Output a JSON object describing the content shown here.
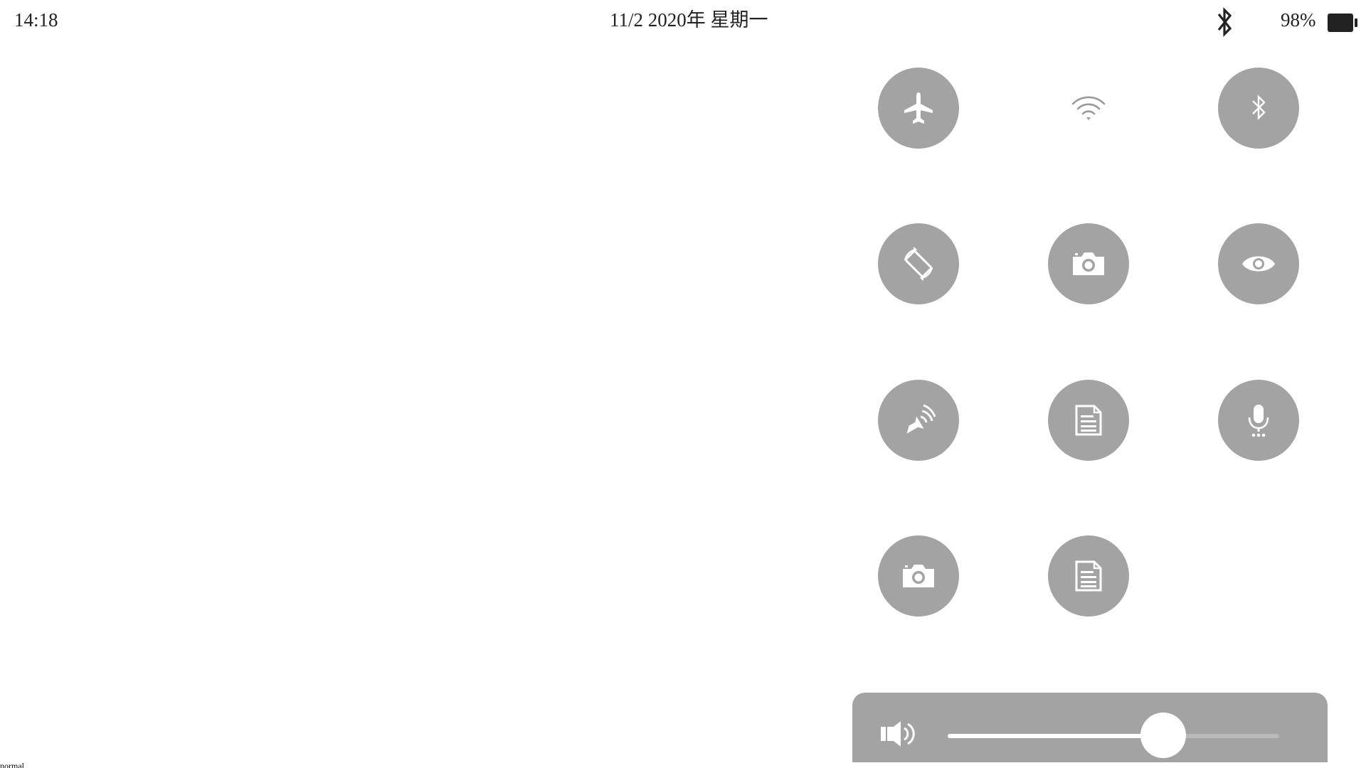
{
  "status_bar": {
    "time": "14:18",
    "date": "11/2 2020年 星期一",
    "bluetooth_icon": "bluetooth-icon",
    "battery_percent": "98%",
    "battery_icon": "battery-icon",
    "battery_level": 0.98
  },
  "controls": [
    {
      "name": "airplane-mode",
      "icon": "airplane-icon",
      "active": true
    },
    {
      "name": "wifi",
      "icon": "wifi-icon",
      "active": false
    },
    {
      "name": "bluetooth",
      "icon": "bluetooth-icon",
      "active": true
    },
    {
      "name": "rotation-lock",
      "icon": "rotate-icon",
      "active": true
    },
    {
      "name": "camera",
      "icon": "camera-icon",
      "active": true
    },
    {
      "name": "eye",
      "icon": "eye-icon",
      "active": true
    },
    {
      "name": "speaker-broadcast",
      "icon": "broadcast-icon",
      "active": true
    },
    {
      "name": "document",
      "icon": "document-icon",
      "active": true
    },
    {
      "name": "microphone",
      "icon": "microphone-icon",
      "active": true
    },
    {
      "name": "camera-2",
      "icon": "camera-icon",
      "active": true
    },
    {
      "name": "document-2",
      "icon": "document-icon",
      "active": true
    }
  ],
  "volume": {
    "icon": "speaker-icon",
    "level": 0.65
  },
  "colors": {
    "button_bg": "#a3a3a3",
    "icon": "#ffffff",
    "text": "#222222"
  },
  "mode_label": "normal"
}
